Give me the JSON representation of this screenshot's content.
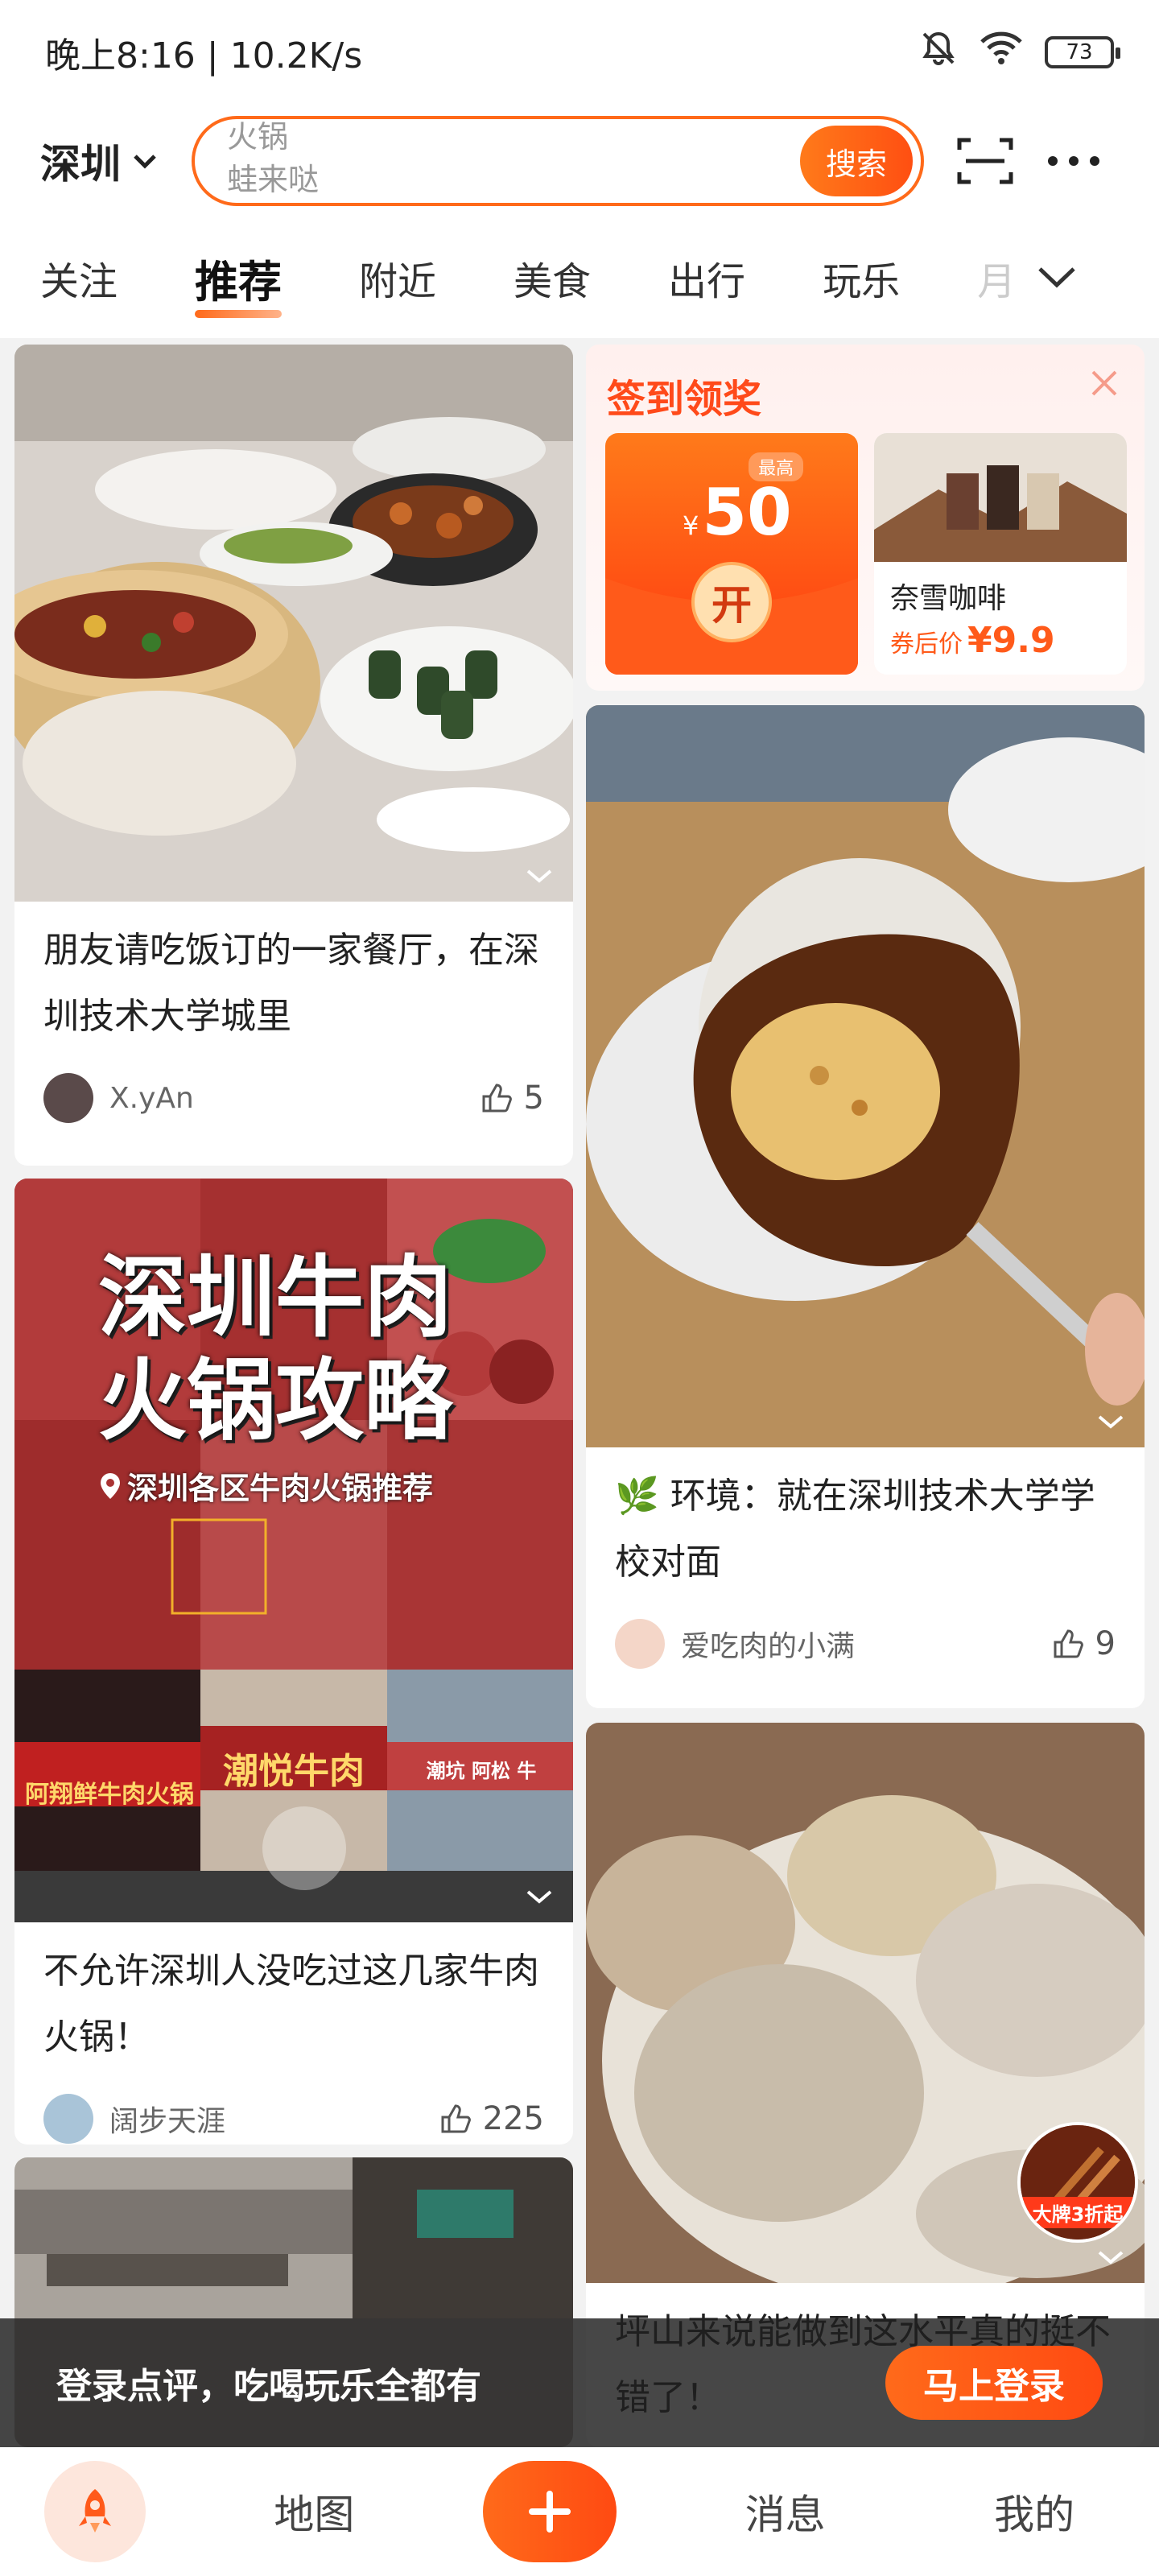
{
  "status_bar": {
    "time_speed": "晚上8:16 | 10.2K/s",
    "battery": "73"
  },
  "header": {
    "city": "深圳",
    "search_hints": [
      "火锅",
      "蛙来哒"
    ],
    "search_button": "搜索"
  },
  "tabs": [
    {
      "label": "关注"
    },
    {
      "label": "推荐"
    },
    {
      "label": "附近"
    },
    {
      "label": "美食"
    },
    {
      "label": "出行"
    },
    {
      "label": "玩乐"
    },
    {
      "label": "月"
    }
  ],
  "signin": {
    "title": "签到领奖",
    "packet_top": "最高",
    "packet_currency": "¥",
    "packet_amount": "50",
    "packet_open": "开",
    "coffee_name": "奈雪咖啡",
    "coffee_price_label": "券后价",
    "coffee_price": "¥9.9"
  },
  "feed": {
    "left": [
      {
        "title": "朋友请吃饭订的一家餐厅，在深圳技术大学城里",
        "author": "X.yAn",
        "likes": "5"
      },
      {
        "overlay_title_1": "深圳牛肉",
        "overlay_title_2": "火锅攻略",
        "overlay_sub": "深圳各区牛肉火锅推荐",
        "sign_1": "阿翔鲜牛肉火锅",
        "sign_2": "潮悦牛肉",
        "sign_3": "潮坑 阿松 牛",
        "title": "不允许深圳人没吃过这几家牛肉火锅！",
        "author": "阔步天涯",
        "likes": "225"
      }
    ],
    "right": [
      {
        "title": "🌿 环境：就在深圳技术大学学校对面",
        "author": "爱吃肉的小满",
        "likes": "9"
      },
      {
        "badge": "大牌3折起",
        "title": "坪山来说能做到这水平真的挺不错了！"
      }
    ]
  },
  "login_bar": {
    "text": "登录点评，吃喝玩乐全都有",
    "button": "马上登录"
  },
  "bottom_nav": {
    "map": "地图",
    "messages": "消息",
    "mine": "我的"
  },
  "colors": {
    "accent": "#ff6a1a",
    "accent_dark": "#ff4a12"
  }
}
